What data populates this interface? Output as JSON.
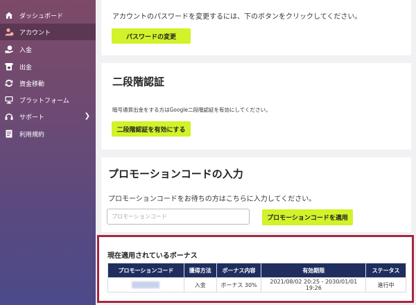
{
  "sidebar": {
    "items": [
      {
        "label": "ダッシュボード",
        "icon": "home-icon"
      },
      {
        "label": "アカウント",
        "icon": "user-icon"
      },
      {
        "label": "入金",
        "icon": "deposit-icon"
      },
      {
        "label": "出金",
        "icon": "withdraw-icon"
      },
      {
        "label": "資金移動",
        "icon": "transfer-icon"
      },
      {
        "label": "プラットフォーム",
        "icon": "platform-icon"
      },
      {
        "label": "サポート",
        "icon": "support-icon"
      },
      {
        "label": "利用規約",
        "icon": "document-icon"
      }
    ],
    "active_index": 1
  },
  "password": {
    "description": "アカウントのパスワードを変更するには、下のボタンをクリックしてください。",
    "button_label": "パスワードの変更"
  },
  "two_factor": {
    "title": "二段階認証",
    "description": "暗号通貨出金をする方はGoogle二段階認証を有効にしてください。",
    "button_label": "二段階認証を有効にする"
  },
  "promo": {
    "title": "プロモーションコードの入力",
    "description": "プロモーションコードをお待ちの方はこちらに入力してください。",
    "input_placeholder": "プロモーションコード",
    "input_value": "",
    "button_label": "プロモーションコードを適用"
  },
  "bonus": {
    "title": "現在適用されているボーナス",
    "columns": [
      "プロモーションコード",
      "獲得方法",
      "ボーナス内容",
      "有効期限",
      "ステータス"
    ],
    "rows": [
      {
        "code": "",
        "method": "入金",
        "content": "ボーナス 30%",
        "expiry": "2021/08/02 20:25 - 2030/01/01 19:26",
        "status": "進行中"
      }
    ]
  },
  "colors": {
    "accent_button": "#d2f229",
    "table_header": "#1f2e5f",
    "highlight_border": "#a5263f",
    "orange_text": "#e5a20a"
  }
}
